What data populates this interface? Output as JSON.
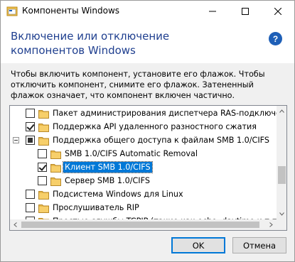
{
  "window": {
    "title": "Компоненты Windows",
    "controls": {
      "minimize": "minimize",
      "maximize": "maximize",
      "close": "close"
    }
  },
  "header": {
    "title": "Включение или отключение компонентов Windows",
    "help_label": "?"
  },
  "description": "Чтобы включить компонент, установите его флажок. Чтобы отключить компонент, снимите его флажок. Затененный флажок означает, что компонент включен частично.",
  "features": [
    {
      "label": "Пакет администрирования диспетчера RAS-подключений (CMAK)",
      "state": "unchecked",
      "indent": 0,
      "expandable": false,
      "selected": false
    },
    {
      "label": "Поддержка API удаленного разностного сжатия",
      "state": "checked",
      "indent": 0,
      "expandable": false,
      "selected": false
    },
    {
      "label": "Поддержка общего доступа к файлам SMB 1.0/CIFS",
      "state": "partial",
      "indent": 0,
      "expandable": true,
      "selected": false
    },
    {
      "label": "SMB 1.0/CIFS Automatic Removal",
      "state": "unchecked",
      "indent": 1,
      "expandable": false,
      "selected": false
    },
    {
      "label": "Клиент SMB 1.0/CIFS",
      "state": "checked",
      "indent": 1,
      "expandable": false,
      "selected": true
    },
    {
      "label": "Сервер SMB 1.0/CIFS",
      "state": "unchecked",
      "indent": 1,
      "expandable": false,
      "selected": false
    },
    {
      "label": "Подсистема Windows для Linux",
      "state": "unchecked",
      "indent": 0,
      "expandable": false,
      "selected": false
    },
    {
      "label": "Прослушиватель RIP",
      "state": "unchecked",
      "indent": 0,
      "expandable": false,
      "selected": false
    },
    {
      "label": "Простые службы TCPIP (такие как echo, daytime и т.п.)",
      "state": "unchecked",
      "indent": 0,
      "expandable": false,
      "selected": false
    }
  ],
  "buttons": {
    "ok": "OK",
    "cancel": "Отмена"
  },
  "colors": {
    "accent": "#0078d7",
    "header_text": "#1f3f8f",
    "folder": "#e8b84a"
  }
}
